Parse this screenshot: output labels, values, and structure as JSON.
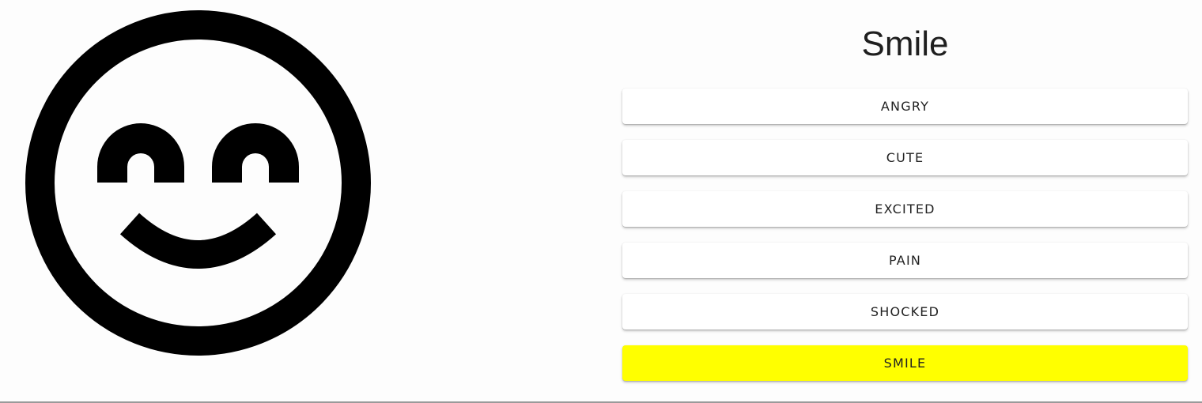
{
  "face": {
    "icon": "smile-face-icon",
    "stroke_color": "#000000"
  },
  "title": "Smile",
  "emotions": [
    {
      "label": "ANGRY",
      "selected": false
    },
    {
      "label": "CUTE",
      "selected": false
    },
    {
      "label": "EXCITED",
      "selected": false
    },
    {
      "label": "PAIN",
      "selected": false
    },
    {
      "label": "SHOCKED",
      "selected": false
    },
    {
      "label": "SMILE",
      "selected": true
    }
  ],
  "colors": {
    "selected_background": "#ffff00",
    "button_background": "#ffffff"
  }
}
